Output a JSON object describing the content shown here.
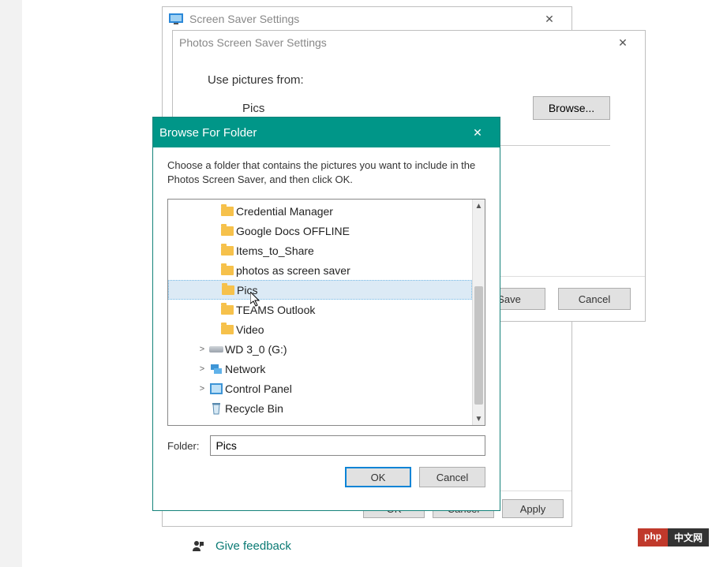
{
  "screensaver": {
    "title": "Screen Saver Settings",
    "ok": "OK",
    "cancel": "Cancel",
    "apply": "Apply"
  },
  "photos": {
    "title": "Photos Screen Saver Settings",
    "use_label": "Use pictures from:",
    "selected_folder": "Pics",
    "browse_btn": "Browse...",
    "save": "Save",
    "cancel": "Cancel"
  },
  "browse": {
    "title": "Browse For Folder",
    "instruction": "Choose a folder that contains the pictures you want to include in the Photos Screen Saver, and then click OK.",
    "folder_label": "Folder:",
    "folder_value": "Pics",
    "ok": "OK",
    "cancel": "Cancel",
    "tree": [
      {
        "indent": 2,
        "icon": "folder",
        "label": "Credential Manager",
        "selected": false
      },
      {
        "indent": 2,
        "icon": "folder",
        "label": "Google Docs OFFLINE",
        "selected": false
      },
      {
        "indent": 2,
        "icon": "folder",
        "label": "Items_to_Share",
        "selected": false
      },
      {
        "indent": 2,
        "icon": "folder",
        "label": "photos as screen saver",
        "selected": false
      },
      {
        "indent": 2,
        "icon": "folder",
        "label": "Pics",
        "selected": true
      },
      {
        "indent": 2,
        "icon": "folder",
        "label": "TEAMS Outlook",
        "selected": false
      },
      {
        "indent": 2,
        "icon": "folder",
        "label": "Video",
        "selected": false
      },
      {
        "indent": 1,
        "icon": "drive",
        "expand": ">",
        "label": "WD 3_0 (G:)",
        "selected": false
      },
      {
        "indent": 1,
        "icon": "network",
        "expand": ">",
        "label": "Network",
        "selected": false
      },
      {
        "indent": 1,
        "icon": "control",
        "expand": ">",
        "label": "Control Panel",
        "selected": false
      },
      {
        "indent": 1,
        "icon": "recycle",
        "label": "Recycle Bin",
        "selected": false
      }
    ]
  },
  "feedback": {
    "label": "Give feedback"
  },
  "watermark": {
    "left": "php",
    "right": "中文网"
  }
}
